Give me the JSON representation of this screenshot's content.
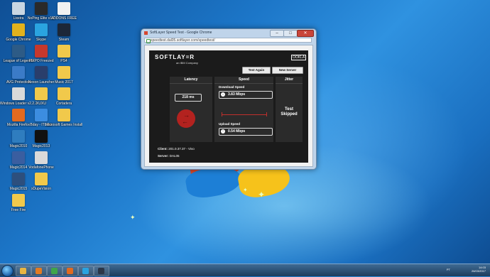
{
  "desktop": {
    "icons": [
      {
        "label": "Lixeira",
        "color": "#c9d6e2"
      },
      {
        "label": "NoPing Elite v1.2",
        "color": "#2a2a2a"
      },
      {
        "label": "ADDONS FREE",
        "color": "#f1f1f1"
      },
      {
        "label": "Google Chrome",
        "color": "#e2b21c"
      },
      {
        "label": "Skype",
        "color": "#2aa3e0"
      },
      {
        "label": "Steam",
        "color": "#1c2738"
      },
      {
        "label": "League of Legends",
        "color": "#2d5b86"
      },
      {
        "label": "PIXPO Freezed",
        "color": "#c6382d"
      },
      {
        "label": "PS4",
        "color": "#f1c94b"
      },
      {
        "label": "AVG Protection",
        "color": "#3b7bc7"
      },
      {
        "label": "Nexon Launcher",
        "color": "#2a3e6b"
      },
      {
        "label": "Music 2017",
        "color": "#f1c94b"
      },
      {
        "label": "Windows Loader v2.2.2",
        "color": "#d9d9d9"
      },
      {
        "label": "XUXU",
        "color": "#f1c94b"
      },
      {
        "label": "Cortadera",
        "color": "#f1c94b"
      },
      {
        "label": "Mozilla Firefox",
        "color": "#e26a1f"
      },
      {
        "label": "Bday - ITLabs",
        "color": "#3c8de0"
      },
      {
        "label": "Microsoft Games Installers",
        "color": "#f1c94b"
      },
      {
        "label": "Magic2010",
        "color": "#2f7dbf"
      },
      {
        "label": "Magic2013",
        "color": "#111111"
      },
      {
        "label": "Magic2014",
        "color": "#3a5ea0"
      },
      {
        "label": "VodafonePhone",
        "color": "#d9d9d9"
      },
      {
        "label": "Magic2015",
        "color": "#2d4f7d"
      },
      {
        "label": "xDupeVision",
        "color": "#f1c94b"
      },
      {
        "label": "Free Fire",
        "color": "#f1c94b"
      }
    ]
  },
  "window": {
    "title": "SoftLayer Speed Test - Google Chrome",
    "url": "speedtest.dal05.softlayer.com/speedtest/",
    "minimize": "–",
    "maximize": "□",
    "close": "✕"
  },
  "speedtest": {
    "logo": "SOFTLAY=R",
    "logo_sub": "an IBM Company",
    "ookla": "OOKLA",
    "test_again": "Test Again",
    "new_server": "New Server",
    "latency_header": "Latency",
    "speed_header": "Speed",
    "jitter_header": "Jitter",
    "latency_value": "218 ms",
    "download_label": "Download Speed",
    "download_value": "3.83 Mbps",
    "upload_label": "Upload Speed",
    "upload_value": "0.54 Mbps",
    "jitter_line1": "Test",
    "jitter_line2": "Skipped",
    "client_label": "Client:",
    "client_value": "201.0.37.37 - Vivo",
    "server_label": "Server:",
    "server_value": "DAL05"
  },
  "taskbar": {
    "apps": [
      {
        "name": "explorer-icon",
        "color": "#e8b542"
      },
      {
        "name": "media-icon",
        "color": "#e37b22"
      },
      {
        "name": "chrome-icon",
        "color": "#3fa54a"
      },
      {
        "name": "firefox-icon",
        "color": "#e26a1f"
      },
      {
        "name": "skype-icon",
        "color": "#2aa3e0"
      },
      {
        "name": "steam-icon",
        "color": "#2b3648"
      }
    ],
    "language": "PT",
    "time": "14:03",
    "date": "26/03/2017"
  }
}
